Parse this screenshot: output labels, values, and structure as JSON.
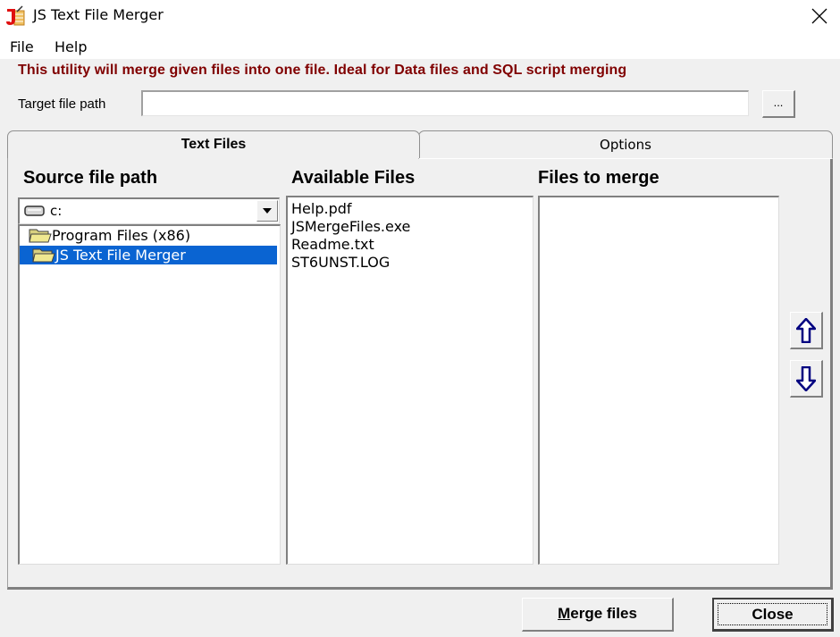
{
  "window": {
    "title": "JS Text File Merger",
    "icon": "app-icon",
    "close_icon": "close-icon"
  },
  "menu": {
    "items": [
      {
        "label": "File"
      },
      {
        "label": "Help"
      }
    ]
  },
  "banner": {
    "text": "This utility will merge given files into one file.  Ideal for Data files and SQL script merging",
    "color": "#800000"
  },
  "target": {
    "label": "Target file path",
    "value": "",
    "browse_label": "..."
  },
  "tabs": [
    {
      "label": "Text Files",
      "active": true
    },
    {
      "label": "Options",
      "active": false
    }
  ],
  "source": {
    "heading": "Source file path",
    "drive": "c:",
    "folders": [
      {
        "label": "Program Files (x86)",
        "selected": false
      },
      {
        "label": "JS Text File Merger",
        "selected": true
      }
    ]
  },
  "available": {
    "heading": "Available Files",
    "files": [
      "Help.pdf",
      "JSMergeFiles.exe",
      "Readme.txt",
      "ST6UNST.LOG"
    ]
  },
  "merge_list": {
    "heading": "Files to merge",
    "files": []
  },
  "reorder": {
    "up_icon": "arrow-up-icon",
    "down_icon": "arrow-down-icon"
  },
  "buttons": {
    "merge_prefix": "M",
    "merge_rest": "erge files",
    "close": "Close"
  },
  "colors": {
    "selection": "#0a64d2",
    "arrow": "#000080"
  }
}
